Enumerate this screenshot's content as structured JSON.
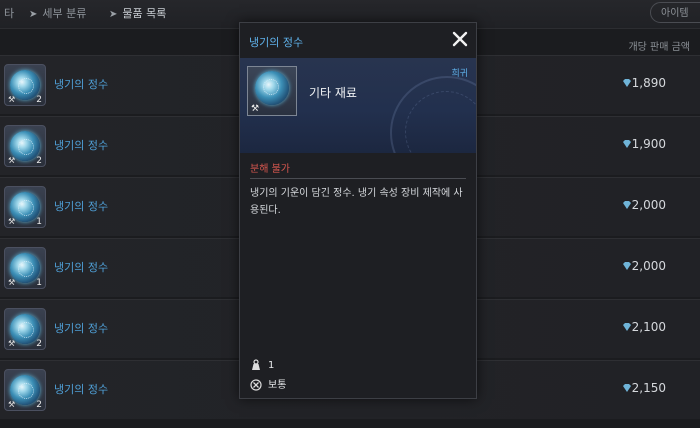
{
  "breadcrumb": {
    "first": "타",
    "second": "세부 분류",
    "third": "물품 목록"
  },
  "search_pill": "아이템",
  "column_header": "개당 판매 금액",
  "rows": [
    {
      "name": "냉기의 정수",
      "count": "2",
      "price": "1,890"
    },
    {
      "name": "냉기의 정수",
      "count": "2",
      "price": "1,900"
    },
    {
      "name": "냉기의 정수",
      "count": "1",
      "price": "2,000"
    },
    {
      "name": "냉기의 정수",
      "count": "1",
      "price": "2,000"
    },
    {
      "name": "냉기의 정수",
      "count": "2",
      "price": "2,100"
    },
    {
      "name": "냉기의 정수",
      "count": "2",
      "price": "2,150"
    }
  ],
  "modal": {
    "title": "냉기의 정수",
    "category": "기타 재료",
    "rarity": "희귀",
    "notice": "분해 불가",
    "description": "냉기의 기운이 담긴 정수. 냉기 속성 장비 제작에 사용된다.",
    "weight": "1",
    "grade": "보통"
  },
  "colors": {
    "accent": "#5fb1ea",
    "warning": "#d7574f",
    "name": "#4f9fd6"
  },
  "icons": [
    "info-icon",
    "compare-icon",
    "scale-icon",
    "bookmark-icon",
    "share-icon",
    "close-icon",
    "gem-icon",
    "weight-icon",
    "grade-icon"
  ]
}
